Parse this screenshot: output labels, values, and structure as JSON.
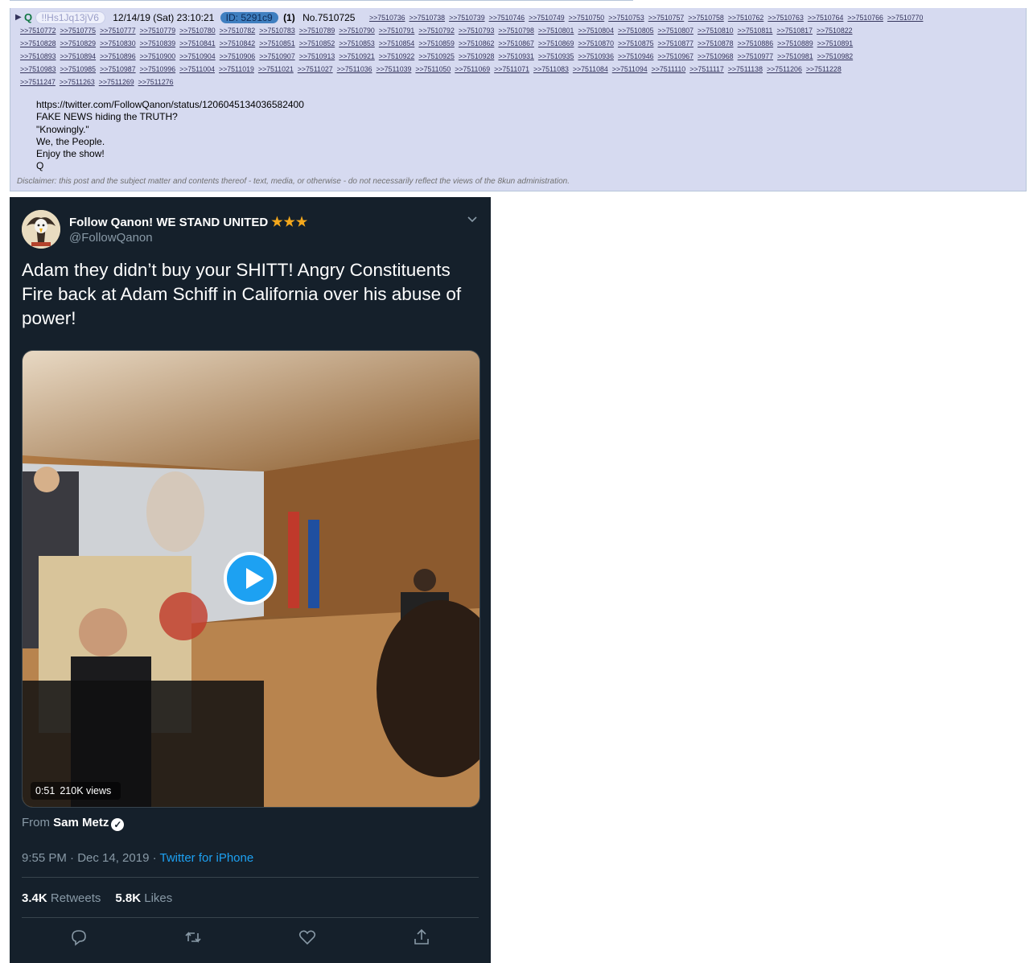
{
  "post": {
    "name": "Q",
    "tripcode": "!!Hs1Jq13jV6",
    "datetime": "12/14/19 (Sat) 23:10:21",
    "id_label": "ID: 5291c9",
    "id_count": "(1)",
    "post_number": "No.7510725",
    "backlinks": [
      ">>7510736",
      ">>7510738",
      ">>7510739",
      ">>7510746",
      ">>7510749",
      ">>7510750",
      ">>7510753",
      ">>7510757",
      ">>7510758",
      ">>7510762",
      ">>7510763",
      ">>7510764",
      ">>7510766",
      ">>7510770",
      ">>7510772",
      ">>7510775",
      ">>7510777",
      ">>7510779",
      ">>7510780",
      ">>7510782",
      ">>7510783",
      ">>7510789",
      ">>7510790",
      ">>7510791",
      ">>7510792",
      ">>7510793",
      ">>7510798",
      ">>7510801",
      ">>7510804",
      ">>7510805",
      ">>7510807",
      ">>7510810",
      ">>7510811",
      ">>7510817",
      ">>7510822",
      ">>7510828",
      ">>7510829",
      ">>7510830",
      ">>7510839",
      ">>7510841",
      ">>7510842",
      ">>7510851",
      ">>7510852",
      ">>7510853",
      ">>7510854",
      ">>7510859",
      ">>7510862",
      ">>7510867",
      ">>7510869",
      ">>7510870",
      ">>7510875",
      ">>7510877",
      ">>7510878",
      ">>7510886",
      ">>7510889",
      ">>7510891",
      ">>7510893",
      ">>7510894",
      ">>7510896",
      ">>7510900",
      ">>7510904",
      ">>7510906",
      ">>7510907",
      ">>7510913",
      ">>7510921",
      ">>7510922",
      ">>7510925",
      ">>7510928",
      ">>7510931",
      ">>7510935",
      ">>7510936",
      ">>7510946",
      ">>7510967",
      ">>7510968",
      ">>7510977",
      ">>7510981",
      ">>7510982",
      ">>7510983",
      ">>7510985",
      ">>7510987",
      ">>7510996",
      ">>7511004",
      ">>7511019",
      ">>7511021",
      ">>7511027",
      ">>7511036",
      ">>7511039",
      ">>7511050",
      ">>7511069",
      ">>7511071",
      ">>7511083",
      ">>7511084",
      ">>7511094",
      ">>7511110",
      ">>7511117",
      ">>7511138",
      ">>7511206",
      ">>7511228",
      ">>7511247",
      ">>7511263",
      ">>7511269",
      ">>7511276"
    ],
    "body_lines": [
      "https://twitter.com/FollowQanon/status/1206045134036582400",
      "FAKE NEWS hiding the TRUTH?",
      "\"Knowingly.\"",
      "We, the People.",
      "Enjoy the show!",
      "Q"
    ],
    "disclaimer": "Disclaimer: this post and the subject matter and contents thereof - text, media, or otherwise - do not necessarily reflect the views of the 8kun administration."
  },
  "tweet": {
    "display_name": "Follow Qanon! WE STAND UNITED",
    "name_stars": "★★★",
    "handle": "@FollowQanon",
    "text": "Adam they didn’t buy your SHITT! Angry Constituents Fire back at Adam Schiff in California over his abuse of power!",
    "video_duration": "0:51",
    "video_views": "210K views",
    "from_prefix": "From",
    "from_name": "Sam Metz",
    "time": "9:55 PM · Dec 14, 2019 · ",
    "source": "Twitter for iPhone",
    "retweets_count": "3.4K",
    "retweets_label": "Retweets",
    "likes_count": "5.8K",
    "likes_label": "Likes",
    "icons": [
      "reply-icon",
      "retweet-icon",
      "like-icon",
      "share-icon"
    ]
  },
  "colors": {
    "post_bg": "#d6daf0",
    "tweet_bg": "#15202b",
    "accent": "#1da1f2",
    "name_green": "#117743"
  }
}
